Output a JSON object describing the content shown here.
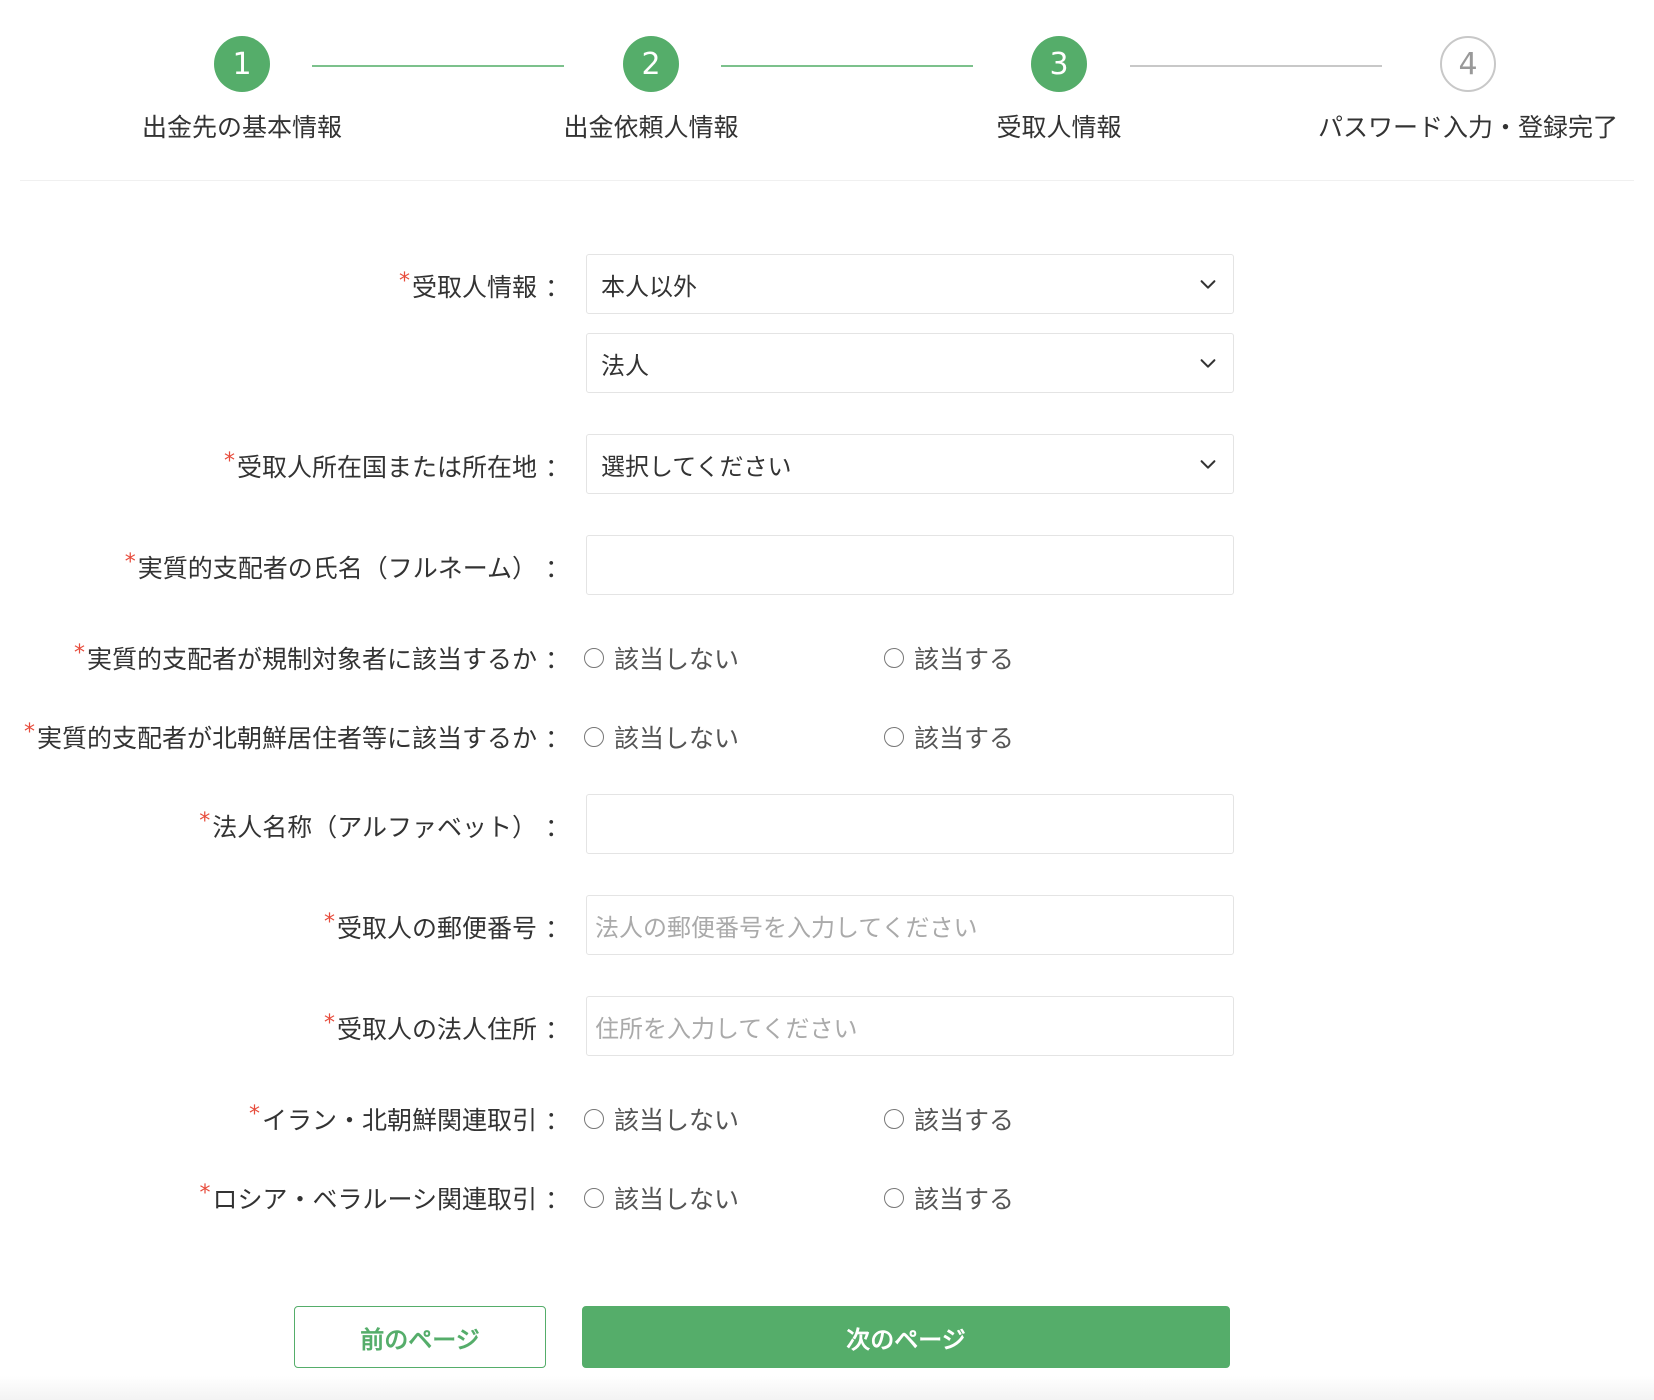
{
  "stepper": {
    "steps": [
      {
        "number": "1",
        "label": "出金先の基本情報",
        "state": "done"
      },
      {
        "number": "2",
        "label": "出金依頼人情報",
        "state": "done"
      },
      {
        "number": "3",
        "label": "受取人情報",
        "state": "done"
      },
      {
        "number": "4",
        "label": "パスワード入力・登録完了",
        "state": "todo"
      }
    ]
  },
  "form": {
    "required_mark": "*",
    "colon": "：",
    "recipient_info": {
      "label": "受取人情報",
      "select1_value": "本人以外",
      "select2_value": "法人"
    },
    "recipient_country": {
      "label": "受取人所在国または所在地",
      "value": "選択してください"
    },
    "beneficial_owner_name": {
      "label": "実質的支配者の氏名（フルネーム）",
      "value": ""
    },
    "owner_sanctioned": {
      "label": "実質的支配者が規制対象者に該当するか",
      "option_no": "該当しない",
      "option_yes": "該当する"
    },
    "owner_north_korea": {
      "label": "実質的支配者が北朝鮮居住者等に該当するか",
      "option_no": "該当しない",
      "option_yes": "該当する"
    },
    "corp_name_alpha": {
      "label": "法人名称（アルファベット）",
      "value": ""
    },
    "recipient_postal": {
      "label": "受取人の郵便番号",
      "placeholder": "法人の郵便番号を入力してください"
    },
    "recipient_address": {
      "label": "受取人の法人住所",
      "placeholder": "住所を入力してください"
    },
    "iran_nk_trade": {
      "label": "イラン・北朝鮮関連取引",
      "option_no": "該当しない",
      "option_yes": "該当する"
    },
    "russia_belarus_trade": {
      "label": "ロシア・ベラルーシ関連取引",
      "option_no": "該当しない",
      "option_yes": "該当する"
    }
  },
  "buttons": {
    "prev_label": "前のページ",
    "next_label": "次のページ"
  },
  "colors": {
    "accent": "#55ad6a",
    "required": "#e74c3c",
    "inactive": "#c8c8c8"
  },
  "icons": {
    "select": "chevron-down-icon",
    "radio": "radio-unchecked-icon"
  }
}
